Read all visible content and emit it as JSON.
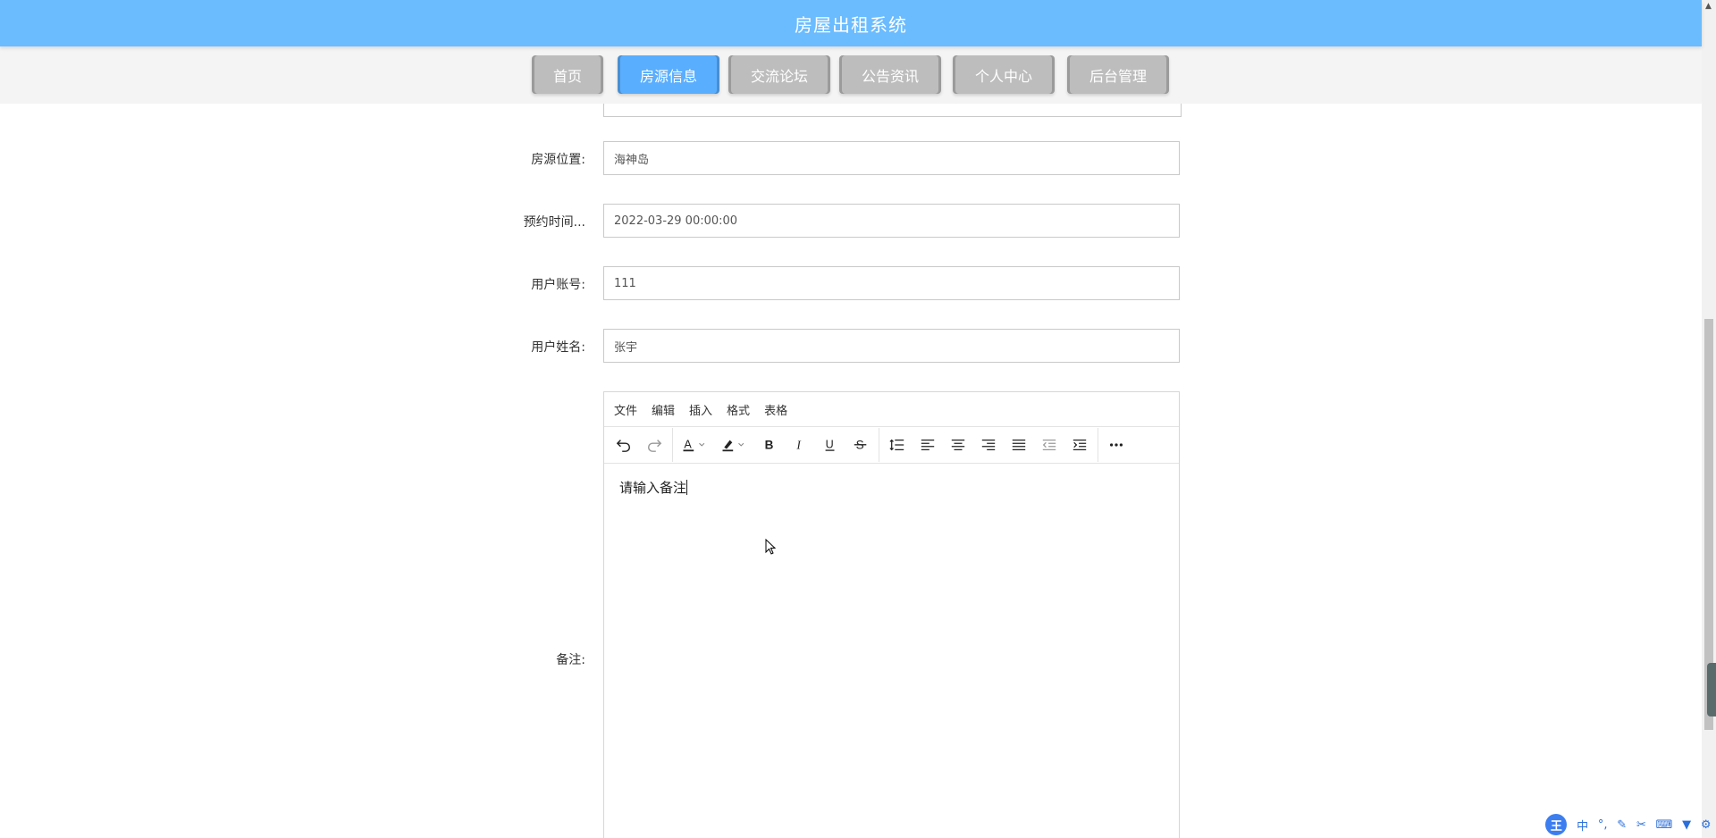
{
  "header": {
    "title": "房屋出租系统"
  },
  "nav": {
    "items": [
      {
        "label": "首页"
      },
      {
        "label": "房源信息"
      },
      {
        "label": "交流论坛"
      },
      {
        "label": "公告资讯"
      },
      {
        "label": "个人中心"
      },
      {
        "label": "后台管理"
      }
    ],
    "active_index": 1
  },
  "form": {
    "location_label": "房源位置:",
    "location_value": "海神岛",
    "time_label": "预约时间...",
    "time_value": "2022-03-29 00:00:00",
    "account_label": "用户账号:",
    "account_value": "111",
    "name_label": "用户姓名:",
    "name_value": "张宇",
    "remark_label": "备注:"
  },
  "editor": {
    "menu": [
      "文件",
      "编辑",
      "插入",
      "格式",
      "表格"
    ],
    "content": "请输入备注",
    "toolbar_icons": [
      "undo-icon",
      "redo-icon",
      "text-color-icon",
      "highlight-icon",
      "bold-icon",
      "italic-icon",
      "underline-icon",
      "strikethrough-icon",
      "line-height-icon",
      "align-left-icon",
      "align-center-icon",
      "align-right-icon",
      "justify-icon",
      "outdent-icon",
      "indent-icon",
      "more-icon"
    ]
  },
  "ime": {
    "logo": "王",
    "mode": "中"
  },
  "colors": {
    "header": "#6bbcff",
    "active_tab": "#5aaefe",
    "tab": "#bdbdbd"
  }
}
